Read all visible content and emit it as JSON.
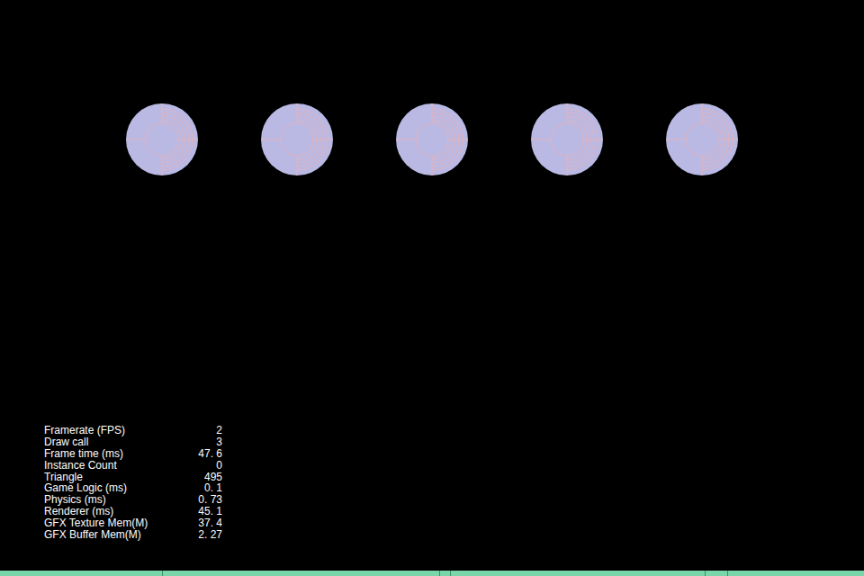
{
  "sprites": [
    {
      "kind": "ring"
    },
    {
      "kind": "ring"
    },
    {
      "kind": "ring"
    },
    {
      "kind": "ring"
    },
    {
      "kind": "ring"
    }
  ],
  "stats": [
    {
      "label": "Framerate (FPS)",
      "value": "2"
    },
    {
      "label": "Draw call",
      "value": "3"
    },
    {
      "label": "Frame time (ms)",
      "value": "47. 6"
    },
    {
      "label": "Instance Count",
      "value": "0"
    },
    {
      "label": "Triangle",
      "value": "495"
    },
    {
      "label": "Game Logic (ms)",
      "value": "0. 1"
    },
    {
      "label": "Physics (ms)",
      "value": "0. 73"
    },
    {
      "label": "Renderer (ms)",
      "value": "45. 1"
    },
    {
      "label": "GFX Texture Mem(M)",
      "value": "37. 4"
    },
    {
      "label": "GFX Buffer Mem(M)",
      "value": "2. 27"
    }
  ]
}
